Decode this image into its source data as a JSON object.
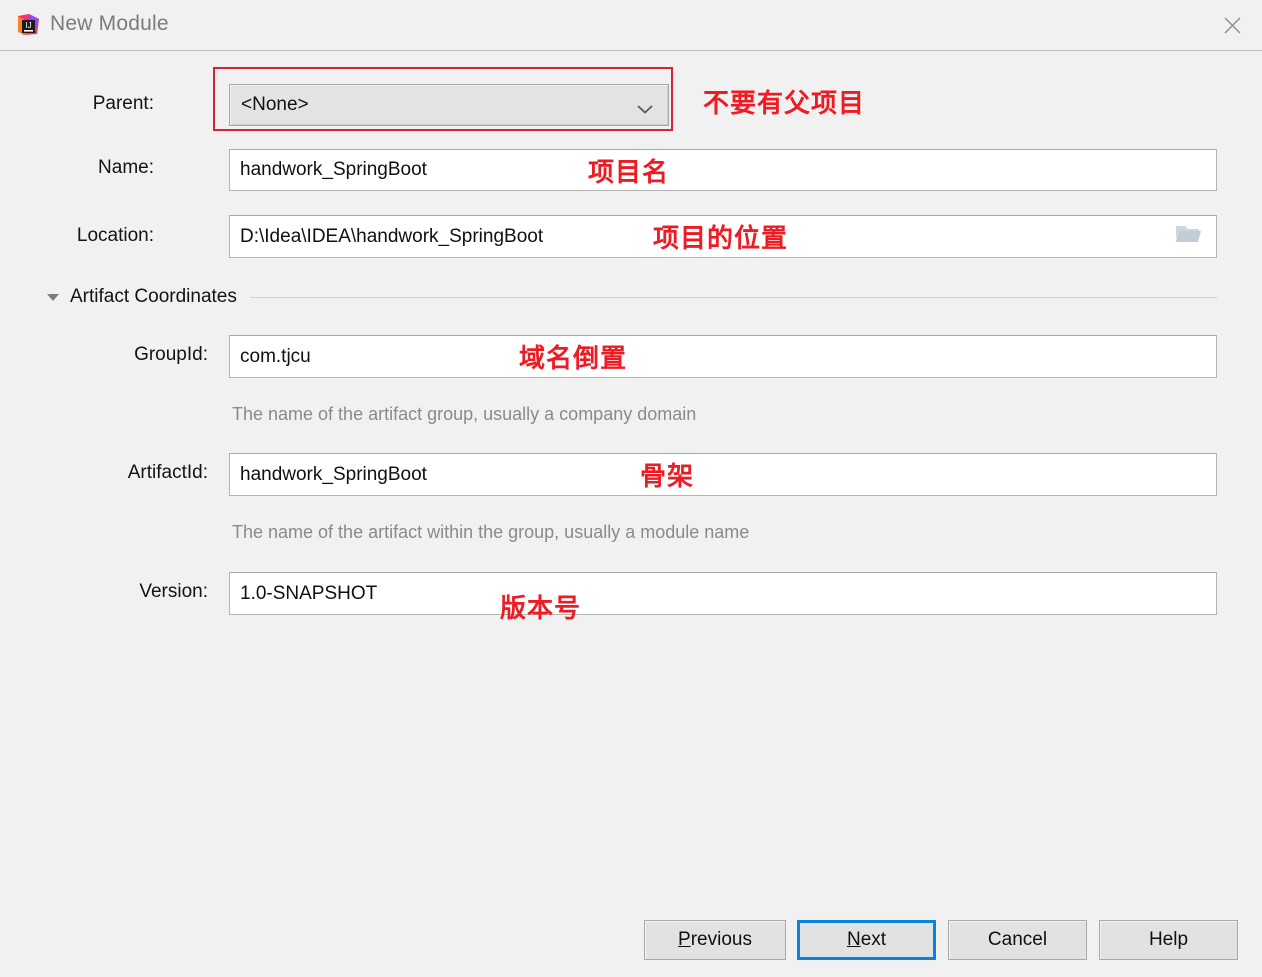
{
  "window": {
    "title": "New Module",
    "app_icon": "intellij-idea-icon",
    "close_icon": "close-icon"
  },
  "form": {
    "parent": {
      "label": "Parent:",
      "value": "<None>",
      "dropdown_icon": "chevron-down-icon",
      "annotation": "不要有父项目"
    },
    "name": {
      "label": "Name:",
      "value": "handwork_SpringBoot",
      "annotation": "项目名"
    },
    "location": {
      "label": "Location:",
      "value": "D:\\Idea\\IDEA\\handwork_SpringBoot",
      "browse_icon": "folder-open-icon",
      "annotation": "项目的位置"
    },
    "artifact_coordinates": {
      "title": "Artifact Coordinates",
      "caret_icon": "triangle-down-icon",
      "group_id": {
        "label": "GroupId:",
        "value": "com.tjcu",
        "hint": "The name of the artifact group, usually a company domain",
        "annotation": "域名倒置"
      },
      "artifact_id": {
        "label": "ArtifactId:",
        "value": "handwork_SpringBoot",
        "hint": "The name of the artifact within the group, usually a module name",
        "annotation": "骨架"
      },
      "version": {
        "label": "Version:",
        "value": "1.0-SNAPSHOT",
        "annotation": "版本号"
      }
    }
  },
  "footer": {
    "previous": {
      "prefix": "",
      "mnemonic": "P",
      "suffix": "revious"
    },
    "next": {
      "prefix": "",
      "mnemonic": "N",
      "suffix": "ext"
    },
    "cancel": "Cancel",
    "help": "Help"
  },
  "colors": {
    "annotation_red": "#ed1c24",
    "highlight_red": "#d62530",
    "focus_blue": "#0a84d8",
    "background": "#f1f1f1"
  }
}
